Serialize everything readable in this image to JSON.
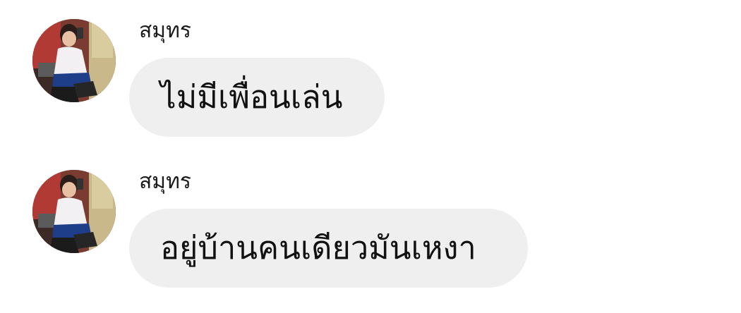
{
  "messages": [
    {
      "sender": "สมุทร",
      "text": "ไม่มีเพื่อนเล่น"
    },
    {
      "sender": "สมุทร",
      "text": "อยู่บ้านคนเดียวมันเหงา"
    }
  ],
  "colors": {
    "background": "#ffffff",
    "bubble": "#efefef",
    "text": "#111111"
  }
}
